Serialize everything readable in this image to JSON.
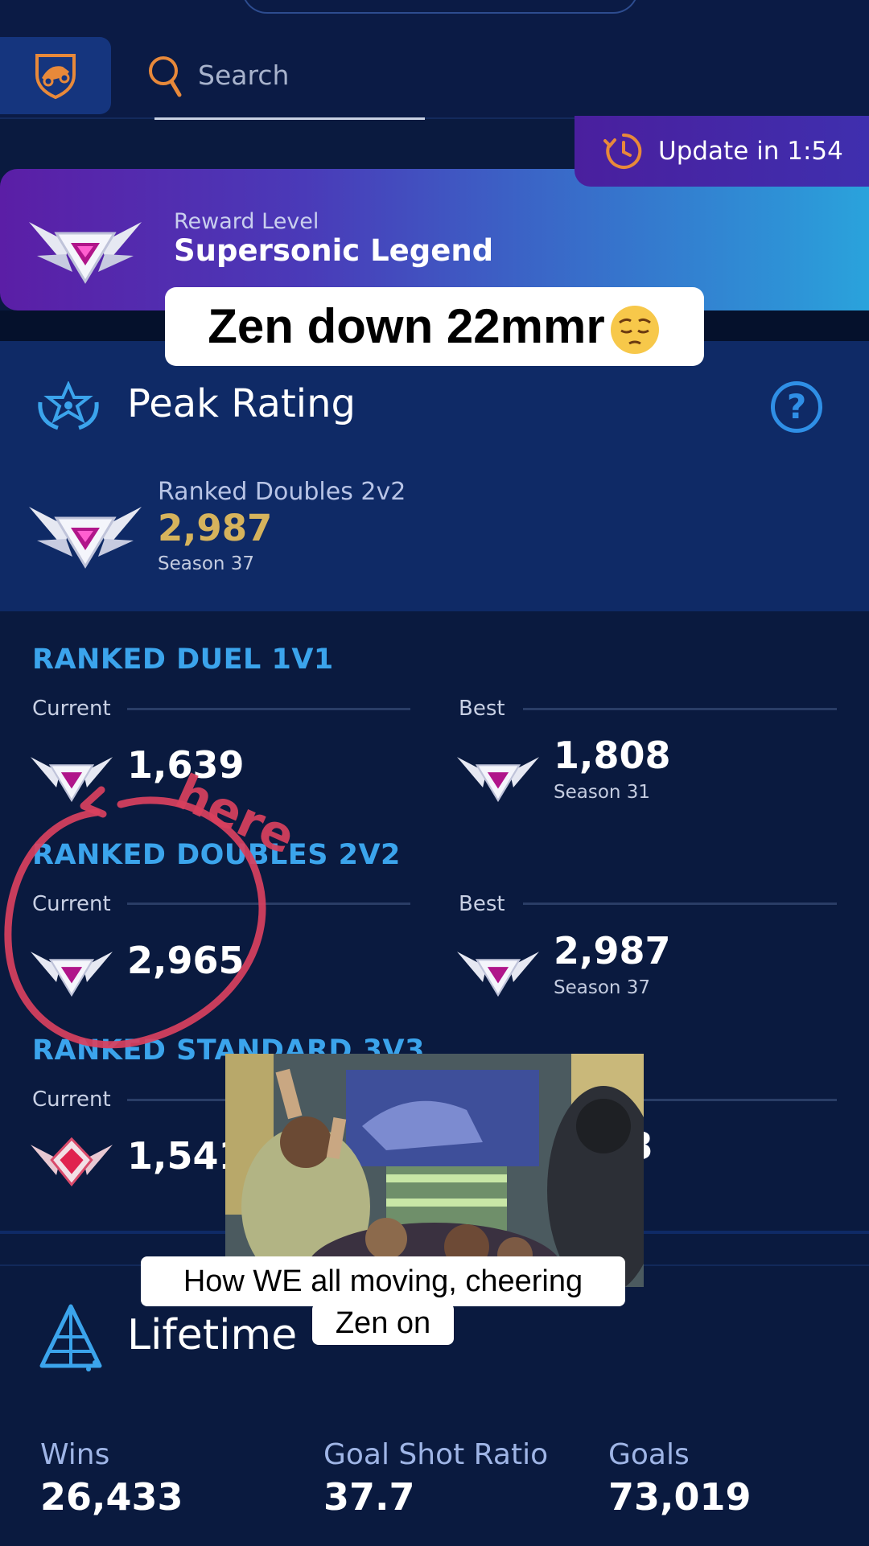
{
  "search": {
    "placeholder": "Search"
  },
  "update": {
    "label": "Update in 1:54"
  },
  "reward": {
    "label": "Reward Level",
    "value": "Supersonic Legend"
  },
  "caption_top": "Zen down 22mmr",
  "peak": {
    "title": "Peak Rating",
    "playlist": "Ranked Doubles 2v2",
    "value": "2,987",
    "season": "Season 37"
  },
  "ranked": {
    "current_label": "Current",
    "best_label": "Best",
    "duel": {
      "title": "RANKED DUEL 1V1",
      "current": "1,639",
      "best": "1,808",
      "best_season": "Season 31"
    },
    "doubles": {
      "title": "RANKED DOUBLES 2V2",
      "current": "2,965",
      "best": "2,987",
      "best_season": "Season 37"
    },
    "standard": {
      "title": "RANKED STANDARD 3V3",
      "current": "1,541",
      "best_partial": "3"
    }
  },
  "annotation_text": "here",
  "caption_bottom": {
    "line1": "How WE all moving, cheering",
    "line2": "Zen on"
  },
  "lifetime": {
    "title": "Lifetime",
    "stats": [
      {
        "label": "Wins",
        "value": "26,433"
      },
      {
        "label": "Goal Shot Ratio",
        "value": "37.7"
      },
      {
        "label": "Goals",
        "value": "73,019"
      }
    ]
  },
  "colors": {
    "accent": "#3ba4ec",
    "peak_value": "#d6b35c",
    "annotation": "#d9405e"
  },
  "icons": [
    "rocket-league-logo",
    "search-icon",
    "timer-icon",
    "peak-rating-icon",
    "help-icon",
    "rank-emblem-ssl",
    "rank-emblem-grand-champion",
    "lifetime-pyramid-icon",
    "grimacing-face-emoji"
  ]
}
